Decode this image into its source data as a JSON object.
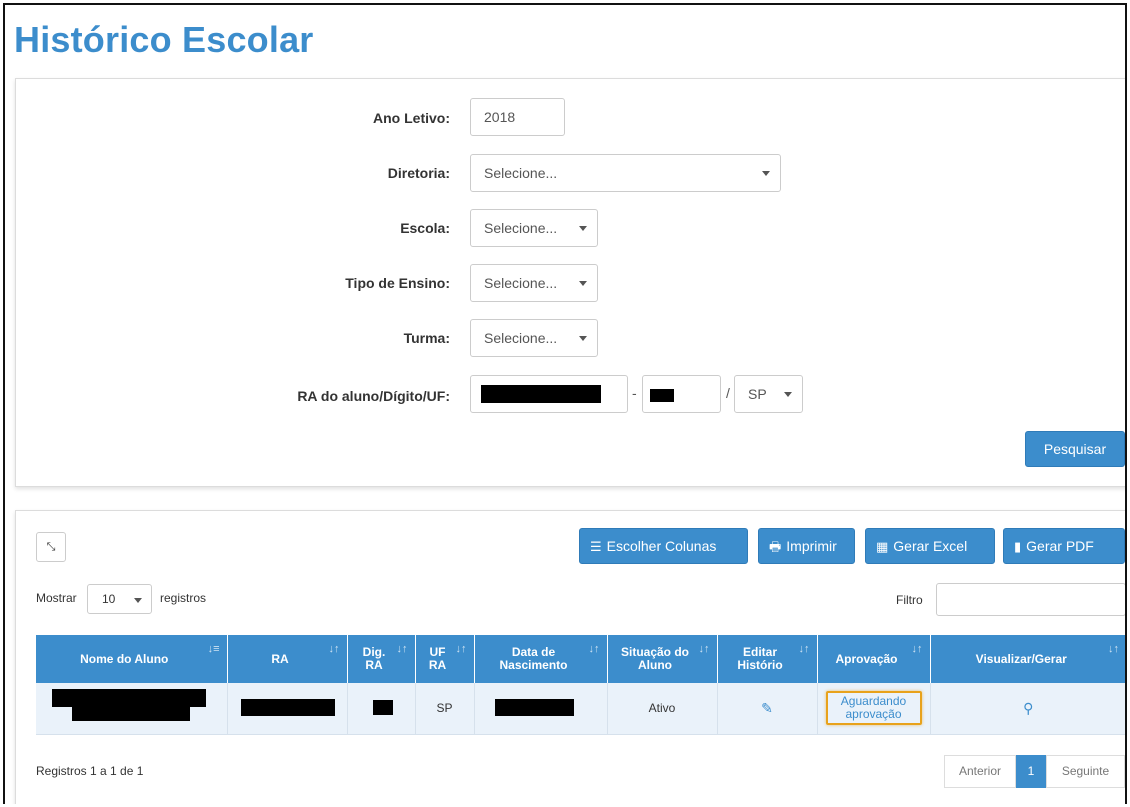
{
  "page": {
    "title": "Histórico Escolar"
  },
  "search_form": {
    "ano_letivo": {
      "label": "Ano Letivo:",
      "value": "2018"
    },
    "diretoria": {
      "label": "Diretoria:",
      "value": "Selecione..."
    },
    "escola": {
      "label": "Escola:",
      "value": "Selecione..."
    },
    "tipo_ensino": {
      "label": "Tipo de Ensino:",
      "value": "Selecione..."
    },
    "turma": {
      "label": "Turma:",
      "value": "Selecione..."
    },
    "ra": {
      "label": "RA do aluno/Dígito/UF:",
      "separator_dash": "-",
      "separator_slash": "/",
      "uf_value": "SP"
    },
    "search_button": "Pesquisar"
  },
  "toolbar": {
    "choose_columns": "Escolher Colunas",
    "print": "Imprimir",
    "excel": "Gerar Excel",
    "pdf": "Gerar PDF"
  },
  "list_controls": {
    "show_label": "Mostrar",
    "page_length": "10",
    "records_label": "registros",
    "filter_label": "Filtro"
  },
  "table": {
    "columns": [
      "Nome do Aluno",
      "RA",
      "Dig. RA",
      "UF RA",
      "Data de Nascimento",
      "Situação do Aluno",
      "Editar Histório",
      "Aprovação",
      "Visualizar/Gerar"
    ],
    "rows": [
      {
        "uf": "SP",
        "situacao": "Ativo",
        "aprovacao": "Aguardando aprovação"
      }
    ]
  },
  "footer": {
    "info": "Registros 1 a 1 de 1",
    "prev": "Anterior",
    "current_page": "1",
    "next": "Seguinte"
  },
  "colors": {
    "accent": "#3c8dcc",
    "highlight": "#e8a21b",
    "row_bg": "#eaf2fa"
  }
}
